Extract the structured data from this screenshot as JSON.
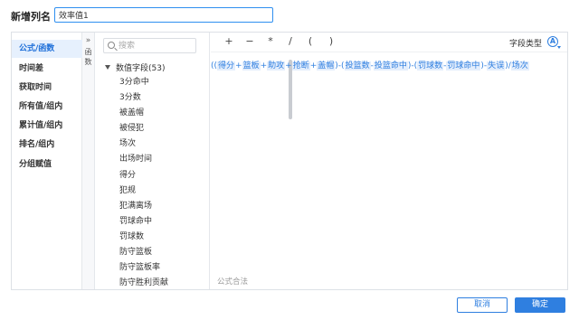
{
  "header": {
    "label": "新增列名",
    "input_value": "效率值1"
  },
  "left_nav": {
    "items": [
      {
        "label": "公式/函数",
        "active": true
      },
      {
        "label": "时间差"
      },
      {
        "label": "获取时间"
      },
      {
        "label": "所有值/组内"
      },
      {
        "label": "累计值/组内"
      },
      {
        "label": "排名/组内"
      },
      {
        "label": "分组赋值"
      }
    ]
  },
  "collapse": {
    "icon": "»",
    "text": "函数"
  },
  "search": {
    "placeholder": "搜索",
    "icon": "search-icon"
  },
  "tree": {
    "group_label": "数值字段(53)",
    "items": [
      "3分命中",
      "3分数",
      "被盖帽",
      "被侵犯",
      "场次",
      "出场时间",
      "得分",
      "犯规",
      "犯满离场",
      "罚球命中",
      "罚球数",
      "防守篮板",
      "防守篮板率",
      "防守胜利贡献"
    ]
  },
  "toolbar": {
    "ops": [
      "+",
      "−",
      "*",
      "/",
      "(",
      ")"
    ],
    "field_type_label": "字段类型",
    "field_type_icon": "A",
    "field_type_icon_name": "field-type-icon"
  },
  "formula": {
    "t0": "((",
    "c1": "得分",
    "t1": "+",
    "c2": "篮板",
    "t2": "+",
    "c3": "助攻",
    "t3": "+",
    "c4": "抢断",
    "t4": "+",
    "c5": "盖帽",
    "t5": ")-(",
    "c6": "投篮数",
    "t6": "-",
    "c7": "投篮命中",
    "t7": ")-(",
    "c8": "罚球数",
    "t8": "-",
    "c9": "罚球命中",
    "t9": ")-",
    "c10": "失误",
    "t10": ")/",
    "c11": "场次"
  },
  "status": "公式合法",
  "buttons": {
    "cancel": "取消",
    "ok": "确定"
  },
  "colors": {
    "accent": "#2f7fe0",
    "nav_active_bg": "#e6f0fd"
  }
}
